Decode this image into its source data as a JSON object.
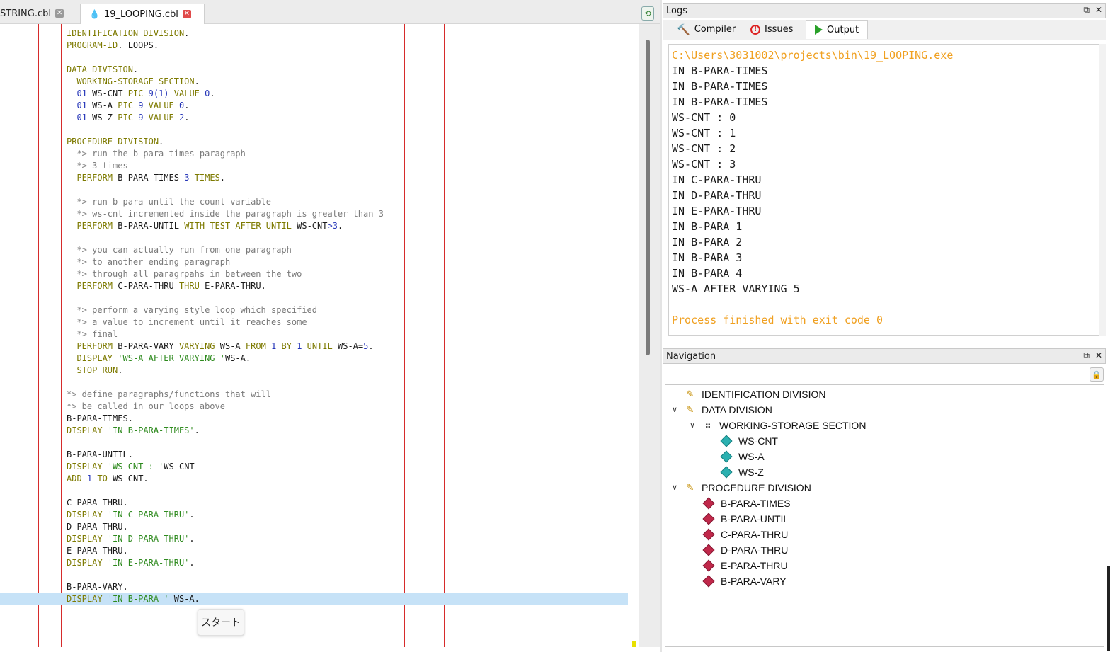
{
  "editor": {
    "tabs": [
      {
        "label": "STRING.cbl",
        "active": false,
        "close": "✕"
      },
      {
        "label": "19_LOOPING.cbl",
        "active": true,
        "close": "✕"
      }
    ],
    "tooltip": "スタート",
    "code_lines": [
      [
        [
          "kw",
          "IDENTIFICATION DIVISION"
        ],
        [
          "plain",
          "."
        ]
      ],
      [
        [
          "kw",
          "PROGRAM-ID"
        ],
        [
          "plain",
          ". LOOPS."
        ]
      ],
      [],
      [
        [
          "kw",
          "DATA DIVISION"
        ],
        [
          "plain",
          "."
        ]
      ],
      [
        [
          "kw",
          "  WORKING-STORAGE SECTION"
        ],
        [
          "plain",
          "."
        ]
      ],
      [
        [
          "num",
          "  01"
        ],
        [
          "plain",
          " WS-CNT "
        ],
        [
          "kw",
          "PIC"
        ],
        [
          "plain",
          " "
        ],
        [
          "num",
          "9(1)"
        ],
        [
          "plain",
          " "
        ],
        [
          "kw",
          "VALUE"
        ],
        [
          "plain",
          " "
        ],
        [
          "num",
          "0"
        ],
        [
          "plain",
          "."
        ]
      ],
      [
        [
          "num",
          "  01"
        ],
        [
          "plain",
          " WS-A "
        ],
        [
          "kw",
          "PIC"
        ],
        [
          "plain",
          " "
        ],
        [
          "num",
          "9"
        ],
        [
          "plain",
          " "
        ],
        [
          "kw",
          "VALUE"
        ],
        [
          "plain",
          " "
        ],
        [
          "num",
          "0"
        ],
        [
          "plain",
          "."
        ]
      ],
      [
        [
          "num",
          "  01"
        ],
        [
          "plain",
          " WS-Z "
        ],
        [
          "kw",
          "PIC"
        ],
        [
          "plain",
          " "
        ],
        [
          "num",
          "9"
        ],
        [
          "plain",
          " "
        ],
        [
          "kw",
          "VALUE"
        ],
        [
          "plain",
          " "
        ],
        [
          "num",
          "2"
        ],
        [
          "plain",
          "."
        ]
      ],
      [],
      [
        [
          "kw",
          "PROCEDURE DIVISION"
        ],
        [
          "plain",
          "."
        ]
      ],
      [
        [
          "cm",
          "  *> run the b-para-times paragraph"
        ]
      ],
      [
        [
          "cm",
          "  *> 3 times"
        ]
      ],
      [
        [
          "kw",
          "  PERFORM"
        ],
        [
          "plain",
          " B-PARA-TIMES "
        ],
        [
          "num",
          "3"
        ],
        [
          "plain",
          " "
        ],
        [
          "kw",
          "TIMES"
        ],
        [
          "plain",
          "."
        ]
      ],
      [],
      [
        [
          "cm",
          "  *> run b-para-until the count variable"
        ]
      ],
      [
        [
          "cm",
          "  *> ws-cnt incremented inside the paragraph is greater than 3"
        ]
      ],
      [
        [
          "kw",
          "  PERFORM"
        ],
        [
          "plain",
          " B-PARA-UNTIL "
        ],
        [
          "kw",
          "WITH TEST AFTER UNTIL"
        ],
        [
          "plain",
          " WS-CNT"
        ],
        [
          "num",
          ">3"
        ],
        [
          "plain",
          "."
        ]
      ],
      [],
      [
        [
          "cm",
          "  *> you can actually run from one paragraph"
        ]
      ],
      [
        [
          "cm",
          "  *> to another ending paragraph"
        ]
      ],
      [
        [
          "cm",
          "  *> through all paragrpahs in between the two"
        ]
      ],
      [
        [
          "kw",
          "  PERFORM"
        ],
        [
          "plain",
          " C-PARA-THRU "
        ],
        [
          "kw",
          "THRU"
        ],
        [
          "plain",
          " E-PARA-THRU."
        ]
      ],
      [],
      [
        [
          "cm",
          "  *> perform a varying style loop which specified"
        ]
      ],
      [
        [
          "cm",
          "  *> a value to increment until it reaches some"
        ]
      ],
      [
        [
          "cm",
          "  *> final"
        ]
      ],
      [
        [
          "kw",
          "  PERFORM"
        ],
        [
          "plain",
          " B-PARA-VARY "
        ],
        [
          "kw",
          "VARYING"
        ],
        [
          "plain",
          " WS-A "
        ],
        [
          "kw",
          "FROM"
        ],
        [
          "plain",
          " "
        ],
        [
          "num",
          "1"
        ],
        [
          "plain",
          " "
        ],
        [
          "kw",
          "BY"
        ],
        [
          "plain",
          " "
        ],
        [
          "num",
          "1"
        ],
        [
          "plain",
          " "
        ],
        [
          "kw",
          "UNTIL"
        ],
        [
          "plain",
          " WS-A="
        ],
        [
          "num",
          "5"
        ],
        [
          "plain",
          "."
        ]
      ],
      [
        [
          "kw",
          "  DISPLAY"
        ],
        [
          "plain",
          " "
        ],
        [
          "str",
          "'WS-A AFTER VARYING '"
        ],
        [
          "plain",
          "WS-A."
        ]
      ],
      [
        [
          "kw",
          "  STOP RUN"
        ],
        [
          "plain",
          "."
        ]
      ],
      [],
      [
        [
          "cm",
          "*> define paragraphs/functions that will"
        ]
      ],
      [
        [
          "cm",
          "*> be called in our loops above"
        ]
      ],
      [
        [
          "plain",
          "B-PARA-TIMES."
        ]
      ],
      [
        [
          "kw",
          "DISPLAY"
        ],
        [
          "plain",
          " "
        ],
        [
          "str",
          "'IN B-PARA-TIMES'"
        ],
        [
          "plain",
          "."
        ]
      ],
      [],
      [
        [
          "plain",
          "B-PARA-UNTIL."
        ]
      ],
      [
        [
          "kw",
          "DISPLAY"
        ],
        [
          "plain",
          " "
        ],
        [
          "str",
          "'WS-CNT : '"
        ],
        [
          "plain",
          "WS-CNT"
        ]
      ],
      [
        [
          "kw",
          "ADD"
        ],
        [
          "plain",
          " "
        ],
        [
          "num",
          "1"
        ],
        [
          "plain",
          " "
        ],
        [
          "kw",
          "TO"
        ],
        [
          "plain",
          " WS-CNT."
        ]
      ],
      [],
      [
        [
          "plain",
          "C-PARA-THRU."
        ]
      ],
      [
        [
          "kw",
          "DISPLAY"
        ],
        [
          "plain",
          " "
        ],
        [
          "str",
          "'IN C-PARA-THRU'"
        ],
        [
          "plain",
          "."
        ]
      ],
      [
        [
          "plain",
          "D-PARA-THRU."
        ]
      ],
      [
        [
          "kw",
          "DISPLAY"
        ],
        [
          "plain",
          " "
        ],
        [
          "str",
          "'IN D-PARA-THRU'"
        ],
        [
          "plain",
          "."
        ]
      ],
      [
        [
          "plain",
          "E-PARA-THRU."
        ]
      ],
      [
        [
          "kw",
          "DISPLAY"
        ],
        [
          "plain",
          " "
        ],
        [
          "str",
          "'IN E-PARA-THRU'"
        ],
        [
          "plain",
          "."
        ]
      ],
      [],
      [
        [
          "plain",
          "B-PARA-VARY."
        ]
      ],
      [
        [
          "kw",
          "DISPLAY"
        ],
        [
          "plain",
          " "
        ],
        [
          "str",
          "'IN B-PARA '"
        ],
        [
          "plain",
          " WS-A."
        ]
      ]
    ]
  },
  "logs": {
    "title": "Logs",
    "controls": [
      "⧉",
      "✕"
    ],
    "tabs": [
      {
        "label": "Compiler",
        "icon": "hammer-icon"
      },
      {
        "label": "Issues",
        "icon": "error-icon"
      },
      {
        "label": "Output",
        "icon": "play-icon",
        "active": true
      }
    ],
    "output": [
      {
        "text": "C:\\Users\\3031002\\projects\\bin\\19_LOOPING.exe",
        "style": "orange"
      },
      {
        "text": "IN B-PARA-TIMES",
        "style": "plain"
      },
      {
        "text": "IN B-PARA-TIMES",
        "style": "plain"
      },
      {
        "text": "IN B-PARA-TIMES",
        "style": "plain"
      },
      {
        "text": "WS-CNT : 0",
        "style": "plain"
      },
      {
        "text": "WS-CNT : 1",
        "style": "plain"
      },
      {
        "text": "WS-CNT : 2",
        "style": "plain"
      },
      {
        "text": "WS-CNT : 3",
        "style": "plain"
      },
      {
        "text": "IN C-PARA-THRU",
        "style": "plain"
      },
      {
        "text": "IN D-PARA-THRU",
        "style": "plain"
      },
      {
        "text": "IN E-PARA-THRU",
        "style": "plain"
      },
      {
        "text": "IN B-PARA 1",
        "style": "plain"
      },
      {
        "text": "IN B-PARA 2",
        "style": "plain"
      },
      {
        "text": "IN B-PARA 3",
        "style": "plain"
      },
      {
        "text": "IN B-PARA 4",
        "style": "plain"
      },
      {
        "text": "WS-A AFTER VARYING 5",
        "style": "plain"
      },
      {
        "text": "",
        "style": "plain"
      },
      {
        "text": "Process finished with exit code 0",
        "style": "orange"
      }
    ]
  },
  "navigation": {
    "title": "Navigation",
    "controls": [
      "⧉",
      "✕"
    ],
    "tree": [
      {
        "label": "IDENTIFICATION DIVISION",
        "level": 0,
        "kind": "division",
        "chevron": ""
      },
      {
        "label": "DATA DIVISION",
        "level": 0,
        "kind": "division",
        "chevron": "∨"
      },
      {
        "label": "WORKING-STORAGE SECTION",
        "level": 1,
        "kind": "section",
        "chevron": "∨"
      },
      {
        "label": "WS-CNT",
        "level": 2,
        "kind": "variable",
        "chevron": ""
      },
      {
        "label": "WS-A",
        "level": 2,
        "kind": "variable",
        "chevron": ""
      },
      {
        "label": "WS-Z",
        "level": 2,
        "kind": "variable",
        "chevron": ""
      },
      {
        "label": "PROCEDURE DIVISION",
        "level": 0,
        "kind": "division",
        "chevron": "∨"
      },
      {
        "label": "B-PARA-TIMES",
        "level": 1,
        "kind": "paragraph",
        "chevron": ""
      },
      {
        "label": "B-PARA-UNTIL",
        "level": 1,
        "kind": "paragraph",
        "chevron": ""
      },
      {
        "label": "C-PARA-THRU",
        "level": 1,
        "kind": "paragraph",
        "chevron": ""
      },
      {
        "label": "D-PARA-THRU",
        "level": 1,
        "kind": "paragraph",
        "chevron": ""
      },
      {
        "label": "E-PARA-THRU",
        "level": 1,
        "kind": "paragraph",
        "chevron": ""
      },
      {
        "label": "B-PARA-VARY",
        "level": 1,
        "kind": "paragraph",
        "chevron": ""
      }
    ]
  },
  "colors": {
    "keyword": "#7d7a00",
    "string": "#2e8a1e",
    "number": "#2535b8",
    "comment": "#7a7a7a",
    "output_highlight": "#f0a020",
    "margin_line": "#d62b2b",
    "current_line": "#c6e2f7"
  }
}
